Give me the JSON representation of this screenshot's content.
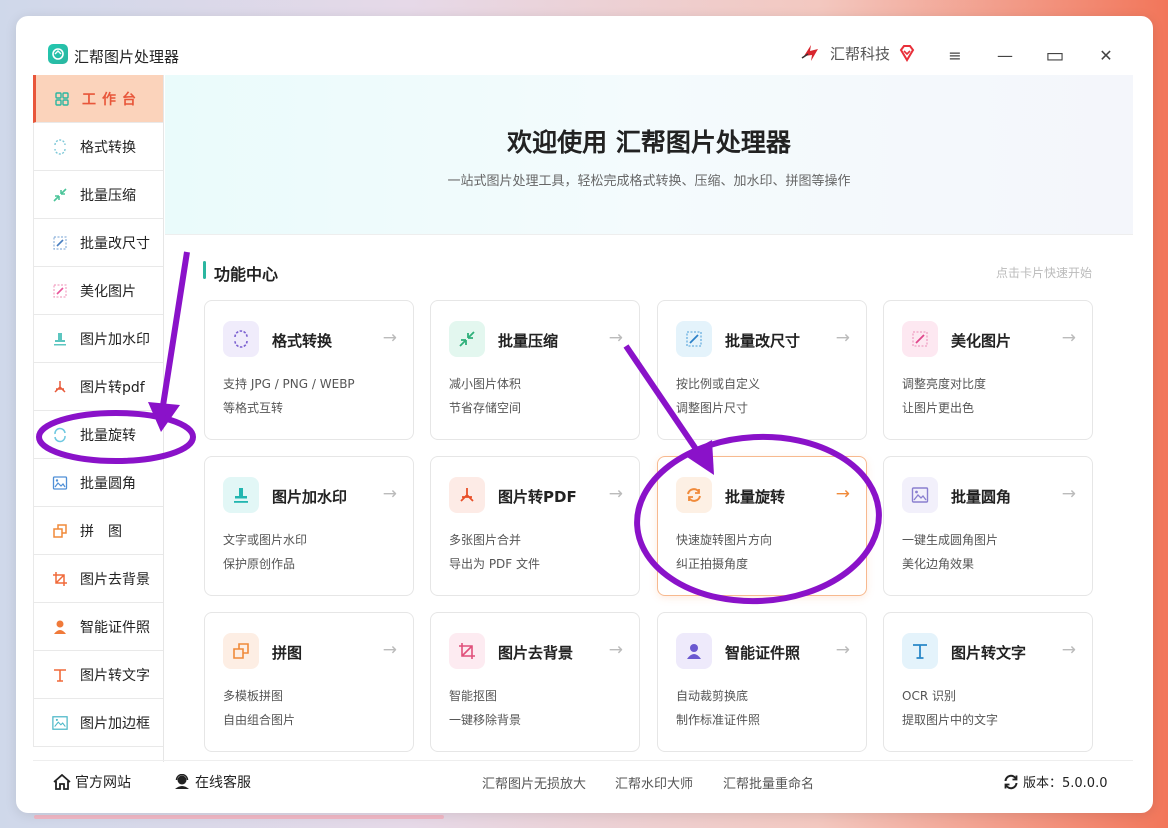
{
  "titlebar": {
    "app_title": "汇帮图片处理器",
    "brand_name": "汇帮科技",
    "menu_icon": "≡",
    "minimize_icon": "—",
    "maximize_icon": "▭",
    "close_icon": "✕"
  },
  "sidebar": {
    "items": [
      {
        "label": "工作台",
        "icon": "grid-icon"
      },
      {
        "label": "格式转换",
        "icon": "convert-icon"
      },
      {
        "label": "批量压缩",
        "icon": "compress-icon"
      },
      {
        "label": "批量改尺寸",
        "icon": "resize-icon"
      },
      {
        "label": "美化图片",
        "icon": "beautify-icon"
      },
      {
        "label": "图片加水印",
        "icon": "watermark-icon"
      },
      {
        "label": "图片转pdf",
        "icon": "pdf-icon"
      },
      {
        "label": "批量旋转",
        "icon": "rotate-icon"
      },
      {
        "label": "批量圆角",
        "icon": "round-corner-icon"
      },
      {
        "label": "拼　图",
        "icon": "collage-icon"
      },
      {
        "label": "图片去背景",
        "icon": "crop-icon"
      },
      {
        "label": "智能证件照",
        "icon": "person-icon"
      },
      {
        "label": "图片转文字",
        "icon": "text-icon"
      },
      {
        "label": "图片加边框",
        "icon": "frame-icon"
      }
    ]
  },
  "banner": {
    "title": "欢迎使用 汇帮图片处理器",
    "subtitle": "一站式图片处理工具，轻松完成格式转换、压缩、加水印、拼图等操作"
  },
  "section": {
    "title": "功能中心",
    "hint": "点击卡片快速开始"
  },
  "cards": [
    {
      "title": "格式转换",
      "line1": "支持 JPG / PNG / WEBP",
      "line2": "等格式互转",
      "arrow": "→"
    },
    {
      "title": "批量压缩",
      "line1": "减小图片体积",
      "line2": "节省存储空间",
      "arrow": "→"
    },
    {
      "title": "批量改尺寸",
      "line1": "按比例或自定义",
      "line2": "调整图片尺寸",
      "arrow": "→"
    },
    {
      "title": "美化图片",
      "line1": "调整亮度对比度",
      "line2": "让图片更出色",
      "arrow": "→"
    },
    {
      "title": "图片加水印",
      "line1": "文字或图片水印",
      "line2": "保护原创作品",
      "arrow": "→"
    },
    {
      "title": "图片转PDF",
      "line1": "多张图片合并",
      "line2": "导出为 PDF 文件",
      "arrow": "→"
    },
    {
      "title": "批量旋转",
      "line1": "快速旋转图片方向",
      "line2": "纠正拍摄角度",
      "arrow": "→"
    },
    {
      "title": "批量圆角",
      "line1": "一键生成圆角图片",
      "line2": "美化边角效果",
      "arrow": "→"
    },
    {
      "title": "拼图",
      "line1": "多模板拼图",
      "line2": "自由组合图片",
      "arrow": "→"
    },
    {
      "title": "图片去背景",
      "line1": "智能抠图",
      "line2": "一键移除背景",
      "arrow": "→"
    },
    {
      "title": "智能证件照",
      "line1": "自动裁剪换底",
      "line2": "制作标准证件照",
      "arrow": "→"
    },
    {
      "title": "图片转文字",
      "line1": "OCR 识别",
      "line2": "提取图片中的文字",
      "arrow": "→"
    }
  ],
  "footer": {
    "website": "官方网站",
    "support": "在线客服",
    "link1": "汇帮图片无损放大",
    "link2": "汇帮水印大师",
    "link3": "汇帮批量重命名",
    "version": "版本：5.0.0.0"
  },
  "colors": {
    "accent": "#e8563a",
    "teal": "#2bb6a0",
    "annotation": "#8a12c9"
  }
}
